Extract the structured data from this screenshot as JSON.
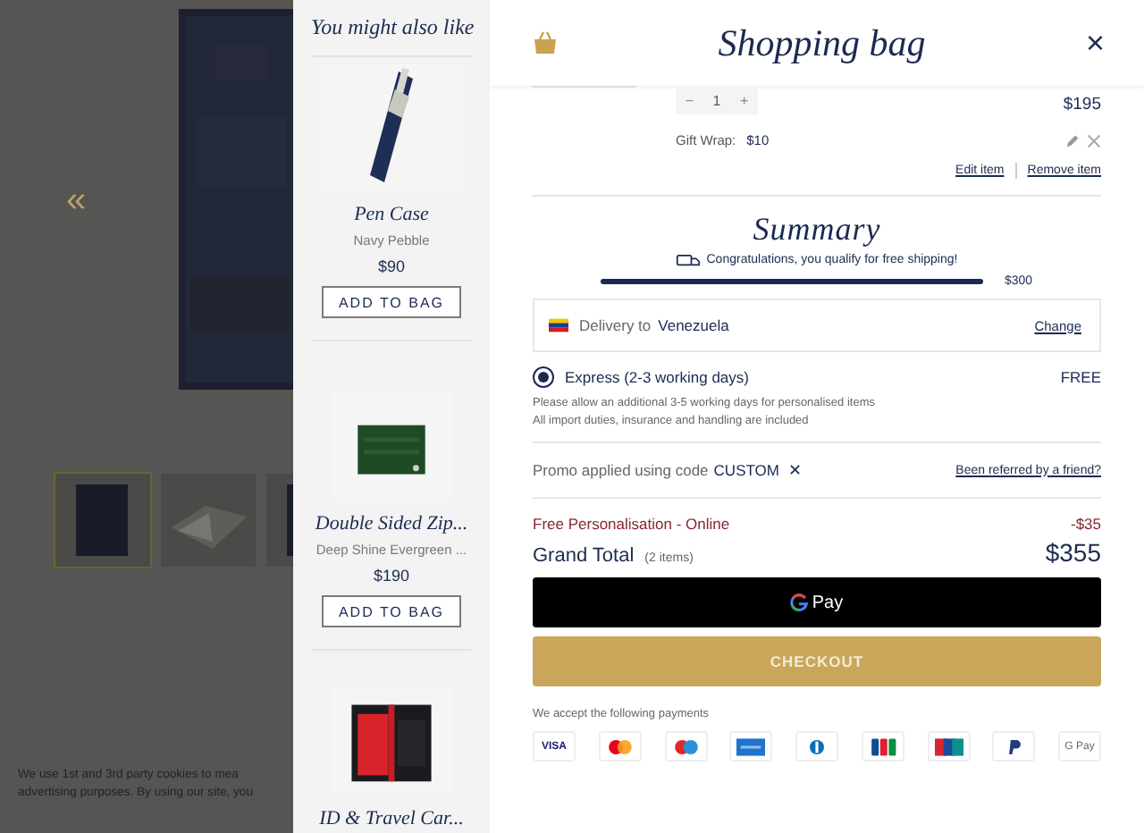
{
  "background_page": {
    "nav_arrow": "«",
    "thumbnails": [
      {
        "selected": true
      },
      {
        "selected": false
      },
      {
        "selected": false
      }
    ],
    "cookie_notice": [
      "We use 1st and 3rd party cookies to mea",
      "advertising purposes. By using our site, you"
    ]
  },
  "recommendations": {
    "title": "You might also like",
    "items": [
      {
        "kind": "pen-case",
        "name": "Pen Case",
        "variant": "Navy Pebble",
        "price": "$90",
        "button": "ADD TO BAG"
      },
      {
        "kind": "zip-wallet",
        "name": "Double Sided Zip...",
        "variant": "Deep Shine Evergreen ...",
        "price": "$190",
        "button": "ADD TO BAG"
      },
      {
        "kind": "id-case",
        "name": "ID & Travel Car..."
      }
    ]
  },
  "bag": {
    "title": "Shopping bag",
    "close": "×",
    "item": {
      "minus": "−",
      "quantity": "1",
      "plus": "+",
      "price": "$195",
      "gift_wrap_label": "Gift Wrap:",
      "gift_wrap_price": "$10",
      "edit": "Edit item",
      "remove": "Remove item"
    },
    "summary": {
      "title": "Summary",
      "free_shipping": "Congratulations, you qualify for free shipping!",
      "level": 1,
      "threshold": "$300",
      "delivery_label": "Delivery to",
      "country": "Venezuela",
      "change": "Change",
      "shipping": {
        "label": "Express (2-3 working days)",
        "price": "FREE",
        "selected": true
      },
      "notes": [
        "Please allow an additional 3-5 working days for personalised items",
        "All import duties, insurance and handling are included"
      ],
      "promo_text": "Promo applied using code",
      "promo_code": "CUSTOM",
      "promo_remove": "✕",
      "referral": "Been referred by a friend?",
      "discount_label": "Free Personalisation - Online",
      "discount": "-$35",
      "total_label": "Grand Total",
      "total_items": "(2 items)",
      "total": "$355"
    },
    "gpay": "Pay",
    "checkout": "CHECKOUT",
    "payments_title": "We accept the following payments",
    "payments": [
      {
        "kind": "visa",
        "label": "VISA"
      },
      {
        "kind": "mastercard"
      },
      {
        "kind": "maestro"
      },
      {
        "kind": "amex"
      },
      {
        "kind": "diners"
      },
      {
        "kind": "jcb"
      },
      {
        "kind": "unionpay"
      },
      {
        "kind": "paypal"
      },
      {
        "kind": "gpay",
        "label": "G Pay"
      }
    ]
  }
}
